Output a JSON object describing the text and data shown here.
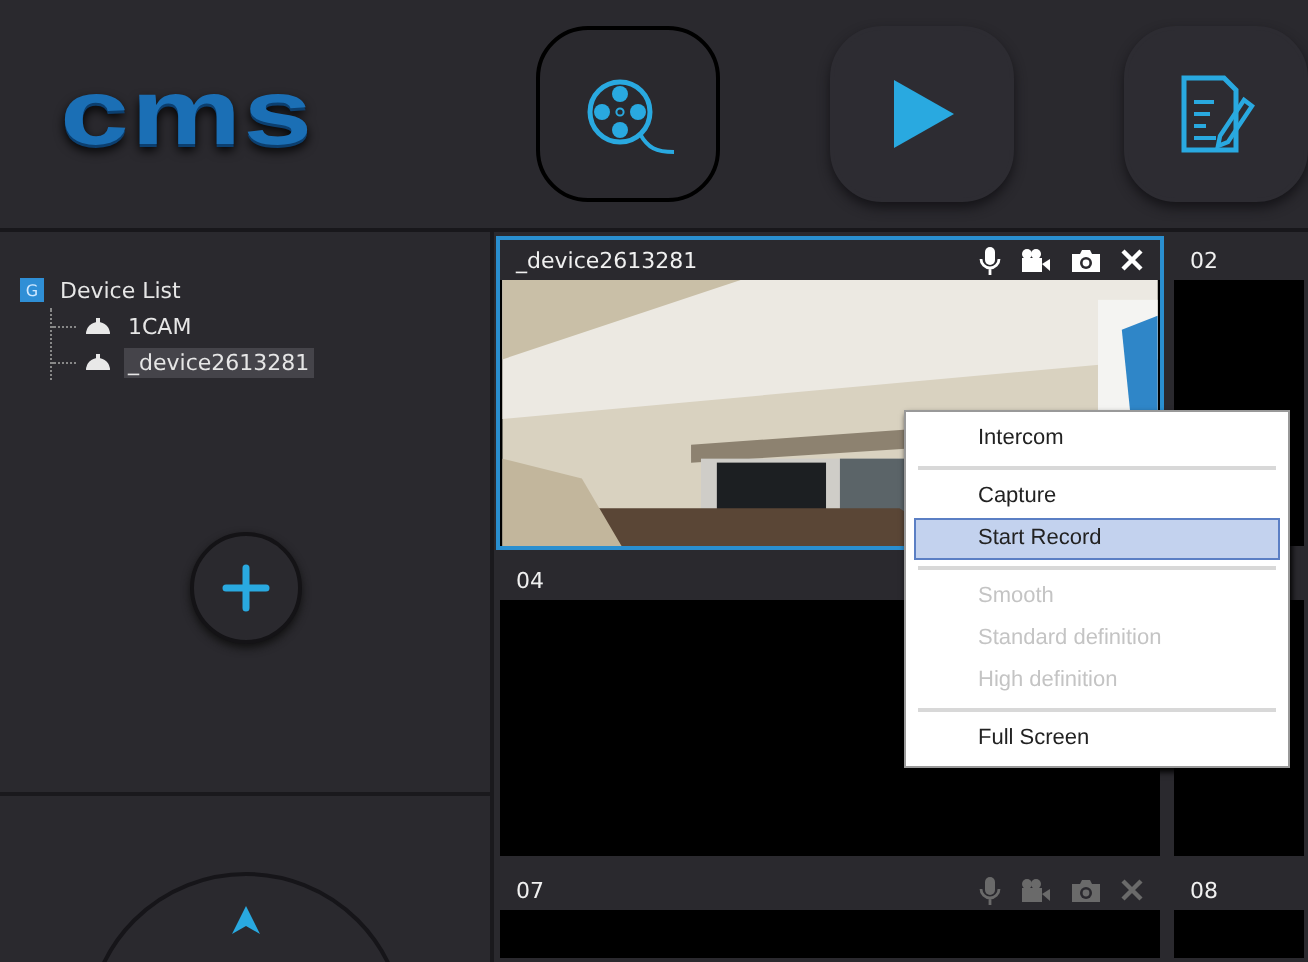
{
  "logo": {
    "text": "cms"
  },
  "toolbar": [
    {
      "kind": "film",
      "selected": true
    },
    {
      "kind": "play",
      "selected": false
    },
    {
      "kind": "edit",
      "selected": false
    }
  ],
  "tree": {
    "badge": "G",
    "label": "Device List",
    "children": [
      {
        "label": "1CAM",
        "selected": false
      },
      {
        "label": "_device2613281",
        "selected": true
      }
    ]
  },
  "cells": [
    {
      "label": "_device2613281",
      "selected": true,
      "kind": "picture",
      "controls_enabled": true
    },
    {
      "label": "02",
      "selected": false
    },
    {
      "label": "04",
      "selected": false
    },
    {
      "selected": false
    },
    {
      "label": "07",
      "selected": false,
      "controls_enabled": false
    },
    {
      "label": "08",
      "selected": false
    }
  ],
  "context_menu": {
    "items": [
      {
        "kind": "item",
        "label": "Intercom",
        "disabled": false,
        "selected": false
      },
      {
        "kind": "separator"
      },
      {
        "kind": "item",
        "label": "Capture",
        "disabled": false,
        "selected": false
      },
      {
        "kind": "item",
        "label": "Start Record",
        "disabled": false,
        "selected": true
      },
      {
        "kind": "separator"
      },
      {
        "kind": "item",
        "label": "Smooth",
        "disabled": true,
        "selected": false
      },
      {
        "kind": "item",
        "label": "Standard definition",
        "disabled": true,
        "selected": false
      },
      {
        "kind": "item",
        "label": "High definition",
        "disabled": true,
        "selected": false
      },
      {
        "kind": "separator"
      },
      {
        "kind": "item",
        "label": "Full Screen",
        "disabled": false,
        "selected": false
      }
    ]
  }
}
